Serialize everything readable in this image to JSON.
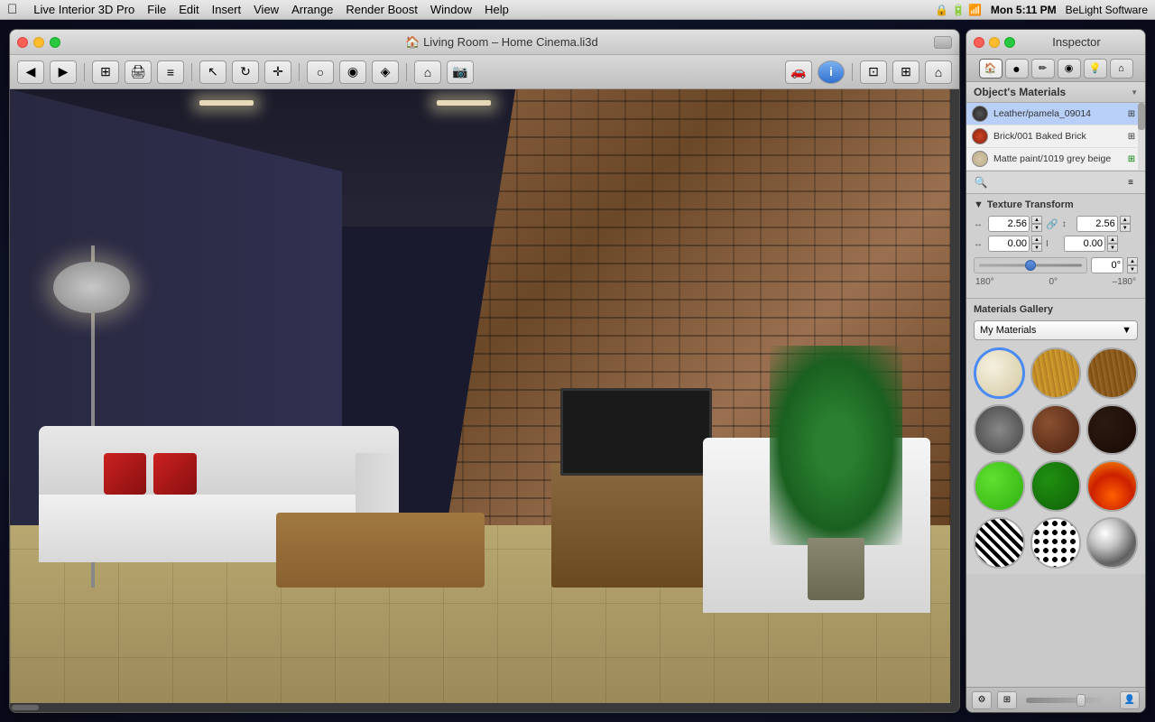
{
  "app": {
    "name": "Live Interior 3D Pro",
    "version": ""
  },
  "menubar": {
    "apple": "⌘",
    "items": [
      "Live Interior 3D Pro",
      "File",
      "Edit",
      "Insert",
      "View",
      "Arrange",
      "Render Boost",
      "Window",
      "Help"
    ],
    "right": {
      "time": "Mon 5:11 PM",
      "company": "BeLight Software"
    }
  },
  "main_window": {
    "title": "Living Room – Home Cinema.li3d",
    "traffic_lights": {
      "red": "",
      "yellow": "",
      "green": ""
    }
  },
  "inspector": {
    "title": "Inspector",
    "tabs": [
      {
        "id": "object",
        "icon": "🏠"
      },
      {
        "id": "material",
        "icon": "●"
      },
      {
        "id": "texture",
        "icon": "✏️"
      },
      {
        "id": "finish",
        "icon": "◉"
      },
      {
        "id": "light",
        "icon": "💡"
      },
      {
        "id": "house",
        "icon": "⌂"
      }
    ],
    "objects_materials": {
      "title": "Object's Materials",
      "items": [
        {
          "name": "Leather/pamela_09014",
          "swatch": "dark_gray"
        },
        {
          "name": "Brick/001 Baked Brick",
          "swatch": "red_brown"
        },
        {
          "name": "Matte paint/1019 grey beige",
          "swatch": "beige"
        }
      ]
    },
    "texture_transform": {
      "title": "Texture Transform",
      "scale_x": "2.56",
      "scale_y": "2.56",
      "offset_x": "0.00",
      "offset_y": "0.00",
      "rotation": "0°",
      "angle_min": "180°",
      "angle_center": "0°",
      "angle_max": "–180°"
    },
    "materials_gallery": {
      "title": "Materials Gallery",
      "dropdown_label": "My Materials",
      "items": [
        {
          "id": "cream",
          "class": "mat-cream",
          "selected": true
        },
        {
          "id": "wood-light",
          "class": "mat-wood-light"
        },
        {
          "id": "wood-dark",
          "class": "mat-wood-dark"
        },
        {
          "id": "stone",
          "class": "mat-stone"
        },
        {
          "id": "brown",
          "class": "mat-brown"
        },
        {
          "id": "dark-brown",
          "class": "mat-dark-brown"
        },
        {
          "id": "green-bright",
          "class": "mat-green-bright"
        },
        {
          "id": "green-dark",
          "class": "mat-green-dark"
        },
        {
          "id": "fire",
          "class": "mat-fire"
        },
        {
          "id": "zebra",
          "class": "mat-zebra"
        },
        {
          "id": "spots",
          "class": "mat-spots"
        },
        {
          "id": "chrome",
          "class": "mat-chrome"
        }
      ]
    }
  }
}
